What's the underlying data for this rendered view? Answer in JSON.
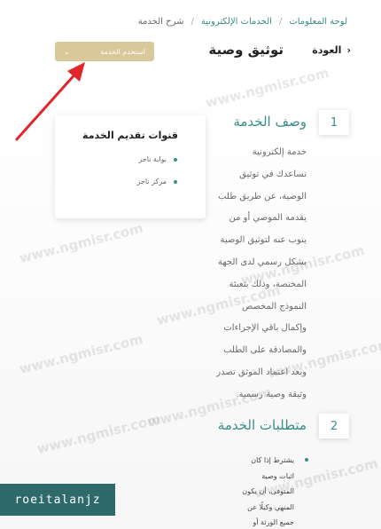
{
  "breadcrumb": {
    "home": "لوحة المعلومات",
    "eservices": "الخدمات الإلكترونية",
    "current": "شرح الخدمة"
  },
  "header": {
    "back": "العودة",
    "title": "توثيق وصية"
  },
  "use_service": {
    "label": "استخدم الخدمة"
  },
  "channels": {
    "title": "قنوات تقديم الخدمة",
    "items": [
      "بوابة ناجز",
      "مركز ناجز"
    ]
  },
  "section1": {
    "number": "1",
    "title": "وصف الخدمة",
    "lines": [
      "خدمة إلكترونية",
      "تساعدك في توثيق",
      "الوصية، عن طريق طلب",
      "يقدمه الموصي أو من",
      "ينوب عنه لتوثيق الوصية",
      "بشكل رسمي لدى الجهة",
      "المختصة، وذلك بتعبئة",
      "النموذج المخصص",
      "وإكمال باقي الإجراءات",
      "والمصادقة على الطلب",
      "وبعد اعتماد الموثق تصدر",
      "وثيقة وصية رسمية."
    ]
  },
  "section2": {
    "number": "2",
    "title": "متطلبات الخدمة",
    "lines": [
      "يشترط إذا كان",
      "اثبات وصية",
      "المتوفى، أن يكون",
      "المنهي وكيلًا عن",
      "جميع الورثة أو"
    ]
  },
  "watermarks": [
    "www.ngmisr.com",
    "www.ngmisr.com",
    "www.ngmisr.com",
    "www.ngmisr.com",
    "www.ngmisr.com",
    "www.ngmisr.com",
    "www.ngmisr.com",
    "www.ngmisr.com",
    "www.ngmisr.com"
  ],
  "badge": {
    "text": "roeitalanjz"
  },
  "colors": {
    "accent": "#3a8e8a",
    "gold": "#d9c89a",
    "arrow": "#e0262a",
    "badge": "#2e6a6a"
  }
}
